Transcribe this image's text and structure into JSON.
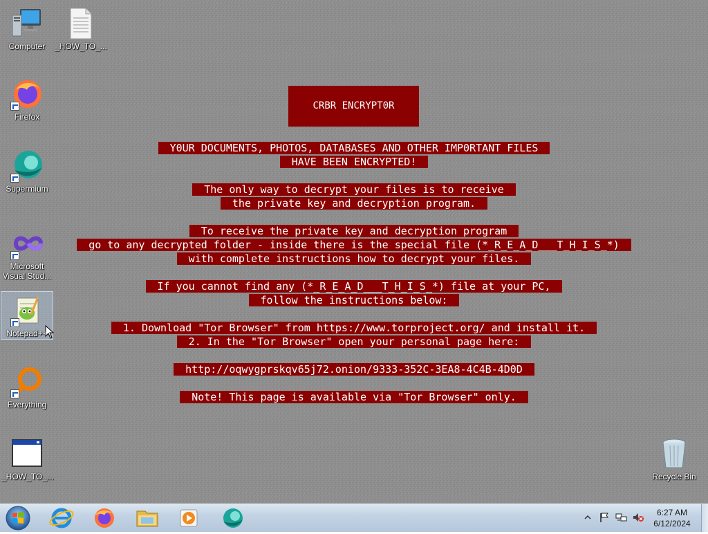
{
  "desktop": {
    "icons": [
      {
        "label": "Computer",
        "icon": "computer-icon"
      },
      {
        "label": "_HOW_TO_...",
        "icon": "text-document-icon"
      },
      {
        "label": "Firefox",
        "icon": "firefox-icon"
      },
      {
        "label": "Supermium",
        "icon": "supermium-icon"
      },
      {
        "label": "Microsoft Visual Stud...",
        "icon": "visual-studio-icon"
      },
      {
        "label": "Notepad++",
        "icon": "notepad-plus-plus-icon"
      },
      {
        "label": "Everything",
        "icon": "everything-search-icon"
      },
      {
        "label": "_HOW_TO_...",
        "icon": "html-document-icon"
      },
      {
        "label": "Recycle Bin",
        "icon": "recycle-bin-icon"
      }
    ]
  },
  "note": {
    "title": "CRBR ENCRYPT0R",
    "lines": [
      "Y0UR DOCUMENTS, PHOTOS, DATABASES AND OTHER IMP0RTANT FILES",
      "HAVE BEEN ENCRYPTED!",
      "The only way to decrypt your files is to receive",
      "the private key and decryption program.",
      "To receive the private key and decryption program",
      "go to any decrypted folder - inside there is the special file (*_R_E_A_D___T_H_I_S_*)",
      "with complete instructions how to decrypt your files.",
      "If you cannot find any (*_R_E_A_D___T_H_I_S_*) file at your PC,",
      "follow the instructions below:",
      "1. Download \"Tor Browser\" from https://www.torproject.org/ and install it.",
      "2. In the \"Tor Browser\" open your personal page here:",
      "http://oqwygprskqv65j72.onion/9333-352C-3EA8-4C4B-4D0D",
      "Note! This page is available via \"Tor Browser\" only."
    ]
  },
  "taskbar": {
    "pinned": [
      "internet-explorer-icon",
      "firefox-icon",
      "file-explorer-icon",
      "media-player-icon",
      "supermium-icon"
    ],
    "clock": {
      "time": "6:27 AM",
      "date": "6/12/2024"
    }
  },
  "colors": {
    "note_bg": "#8b0000",
    "desktop_bg": "#8e8e8e"
  }
}
